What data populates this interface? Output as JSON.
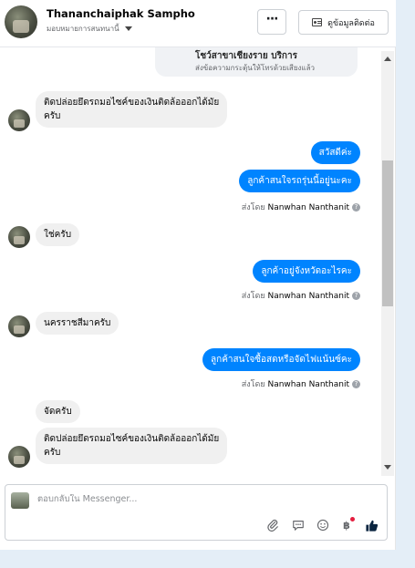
{
  "header": {
    "name": "Thananchaiphak Sampho",
    "subtitle": "มอบหมายการสนทนานี้",
    "more_label": "···",
    "profile_label": "ดูข้อมูลติดต่อ"
  },
  "thread": {
    "card_title": "โชว์สาขาเชียงราย บริการ",
    "card_subtitle": "ส่งข้อความกระตุ้นให้โทรด้วยเสียงแล้ว",
    "messages": [
      {
        "side": "in",
        "text": "ติดปล่อยยึดรถมอไซค์ของเงินติดล้อออกได้มัย\nครับ"
      },
      {
        "side": "out",
        "text": "สวัสดีค่ะ"
      },
      {
        "side": "out",
        "text": "ลูกค้าสนใจรถรุ่นนี้อยู่นะคะ"
      },
      {
        "side": "in",
        "text": "ใช่ครับ"
      },
      {
        "side": "out",
        "text": "ลูกค้าอยู่จังหวัดอะไรคะ"
      },
      {
        "side": "in",
        "text": "นครราชสีมาครับ"
      },
      {
        "side": "out",
        "text": "ลูกค้าสนใจซื้อสดหรือจัดไฟแน้นซ์คะ"
      },
      {
        "side": "in",
        "text": "จัดครับ"
      },
      {
        "side": "in",
        "text": "ติดปล่อยยึดรถมอไซค์ของเงินติดล้อออกได้มัย\nครับ"
      }
    ],
    "sent_by_prefix": "ส่งโดย",
    "sent_by_name": "Nanwhan Nanthanit"
  },
  "composer": {
    "placeholder": "ตอบกลับใน Messenger...",
    "value": ""
  },
  "icons": [
    "paperclip-icon",
    "chat-bubble-icon",
    "emoji-icon",
    "baht-icon",
    "thumbs-up-icon"
  ],
  "colors": {
    "outgoing_bubble": "#0084ff",
    "incoming_bubble": "#f0f0f0",
    "notification_dot": "#e41e3f"
  }
}
